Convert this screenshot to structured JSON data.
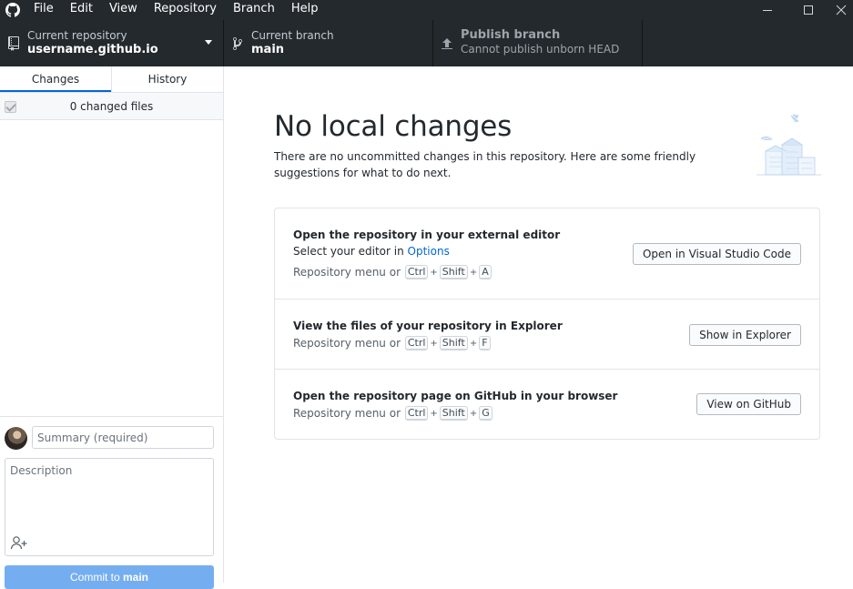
{
  "menubar": {
    "items": [
      "File",
      "Edit",
      "View",
      "Repository",
      "Branch",
      "Help"
    ],
    "icons": {
      "logo": "github-octocat-icon",
      "minimize": "minimize-icon",
      "maximize": "maximize-icon",
      "close": "close-icon"
    }
  },
  "toolbar": {
    "repository": {
      "label": "Current repository",
      "value": "username.github.io",
      "icon": "repo-icon"
    },
    "branch": {
      "label": "Current branch",
      "value": "main",
      "icon": "git-branch-icon"
    },
    "publish": {
      "label": "Publish branch",
      "value": "Cannot publish unborn HEAD",
      "icon": "upload-arrow-icon"
    }
  },
  "sidebar": {
    "tabs": [
      "Changes",
      "History"
    ],
    "changes_count": "0 changed files",
    "commit": {
      "summary_placeholder": "Summary (required)",
      "description_placeholder": "Description",
      "button_prefix": "Commit to ",
      "button_branch": "main"
    }
  },
  "main": {
    "title": "No local changes",
    "subtitle": "There are no uncommitted changes in this repository. Here are some friendly suggestions for what to do next.",
    "suggestions": [
      {
        "title": "Open the repository in your external editor",
        "line_prefix": "Select your editor in ",
        "line_link": "Options",
        "hint": "Repository menu or",
        "keys": [
          "Ctrl",
          "Shift",
          "A"
        ],
        "button": "Open in Visual Studio Code"
      },
      {
        "title": "View the files of your repository in Explorer",
        "hint": "Repository menu or",
        "keys": [
          "Ctrl",
          "Shift",
          "F"
        ],
        "button": "Show in Explorer"
      },
      {
        "title": "Open the repository page on GitHub in your browser",
        "hint": "Repository menu or",
        "keys": [
          "Ctrl",
          "Shift",
          "G"
        ],
        "button": "View on GitHub"
      }
    ]
  },
  "colors": {
    "titlebar": "#24292e",
    "accent": "#0366d6",
    "commit_button": "#74aef0"
  }
}
